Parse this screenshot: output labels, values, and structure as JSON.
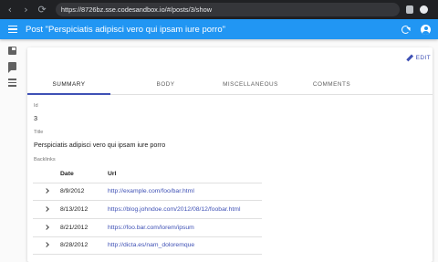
{
  "browser": {
    "back_icon": "‹",
    "forward_icon": "›",
    "reload_icon": "⟳",
    "url": "https://8726bz.sse.codesandbox.io/#/posts/3/show"
  },
  "appbar": {
    "title": "Post \"Perspiciatis adipisci vero qui ipsam iure porro\"",
    "color": "#2196f3"
  },
  "sidebar": {
    "items": [
      {
        "icon": "book-icon"
      },
      {
        "icon": "chat-icon"
      },
      {
        "icon": "list-icon"
      }
    ]
  },
  "actions": {
    "edit_label": "EDIT"
  },
  "tabs": [
    {
      "label": "SUMMARY",
      "active": true
    },
    {
      "label": "BODY"
    },
    {
      "label": "MISCELLANEOUS"
    },
    {
      "label": "COMMENTS"
    }
  ],
  "fields": {
    "id_label": "Id",
    "id_value": "3",
    "title_label": "Title",
    "title_value": "Perspiciatis adipisci vero qui ipsam iure porro",
    "backlinks_label": "Backlinks"
  },
  "backlinks": {
    "headers": {
      "date": "Date",
      "url": "Url"
    },
    "rows": [
      {
        "date": "8/9/2012",
        "url": "http://example.com/foo/bar.html"
      },
      {
        "date": "8/13/2012",
        "url": "https://blog.johndoe.com/2012/08/12/foobar.html"
      },
      {
        "date": "8/21/2012",
        "url": "https://foo.bar.com/lorem/ipsum"
      },
      {
        "date": "8/28/2012",
        "url": "http://dicta.es/nam_doloremque"
      }
    ]
  },
  "colors": {
    "accent": "#3f51b5",
    "primary": "#2196f3"
  }
}
